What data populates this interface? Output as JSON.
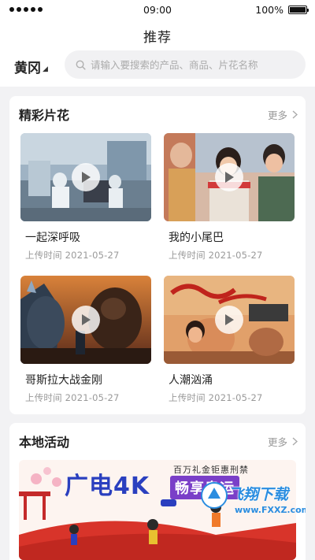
{
  "status_bar": {
    "time": "09:00",
    "battery": "100%"
  },
  "header": {
    "title": "推荐",
    "city": "黄冈",
    "search_placeholder": "请输入要搜索的产品、商品、片花名称"
  },
  "highlights": {
    "title": "精彩片花",
    "more_label": "更多",
    "videos": [
      {
        "title": "一起深呼吸",
        "date": "上传时间 2021-05-27"
      },
      {
        "title": "我的小尾巴",
        "date": "上传时间 2021-05-27"
      },
      {
        "title": "哥斯拉大战金刚",
        "date": "上传时间 2021-05-27"
      },
      {
        "title": "人潮汹涌",
        "date": "上传时间 2021-05-27"
      }
    ]
  },
  "local": {
    "title": "本地活动",
    "more_label": "更多",
    "banner": {
      "title_part1": "广电",
      "title_part2": "4K",
      "subtitle_top": "百万礼金钜惠刑禁",
      "subtitle": "畅享奥运"
    }
  },
  "watermark": {
    "text": "飞翔下载",
    "url": "www.FXXZ.com"
  },
  "colors": {
    "accent_blue": "#2a3fbf",
    "banner_purple": "#7a3fc8",
    "page_bg": "#f2f2f4"
  }
}
